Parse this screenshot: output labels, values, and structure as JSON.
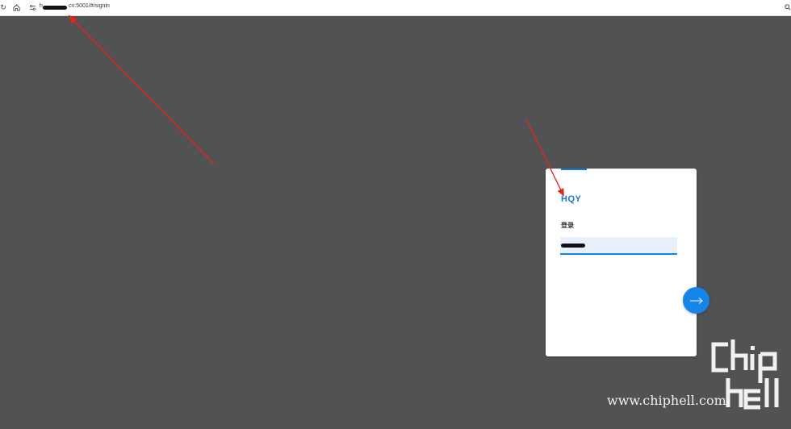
{
  "browser": {
    "url_visible": "cn:5001/#/signin",
    "url_prefix": "h",
    "icons": [
      "reload-icon",
      "home-icon",
      "site-settings-icon",
      "zoom-icon"
    ]
  },
  "login_card": {
    "brand": "HQY",
    "title": "登录",
    "username_value": ""
  },
  "next_button": {
    "icon": "arrow-right-icon"
  },
  "watermark": {
    "site": "www.chiphell.com",
    "logo_text": "chip hell"
  },
  "colors": {
    "background": "#515254",
    "accent": "#1585e8",
    "annotation_arrow": "#e0261b"
  }
}
